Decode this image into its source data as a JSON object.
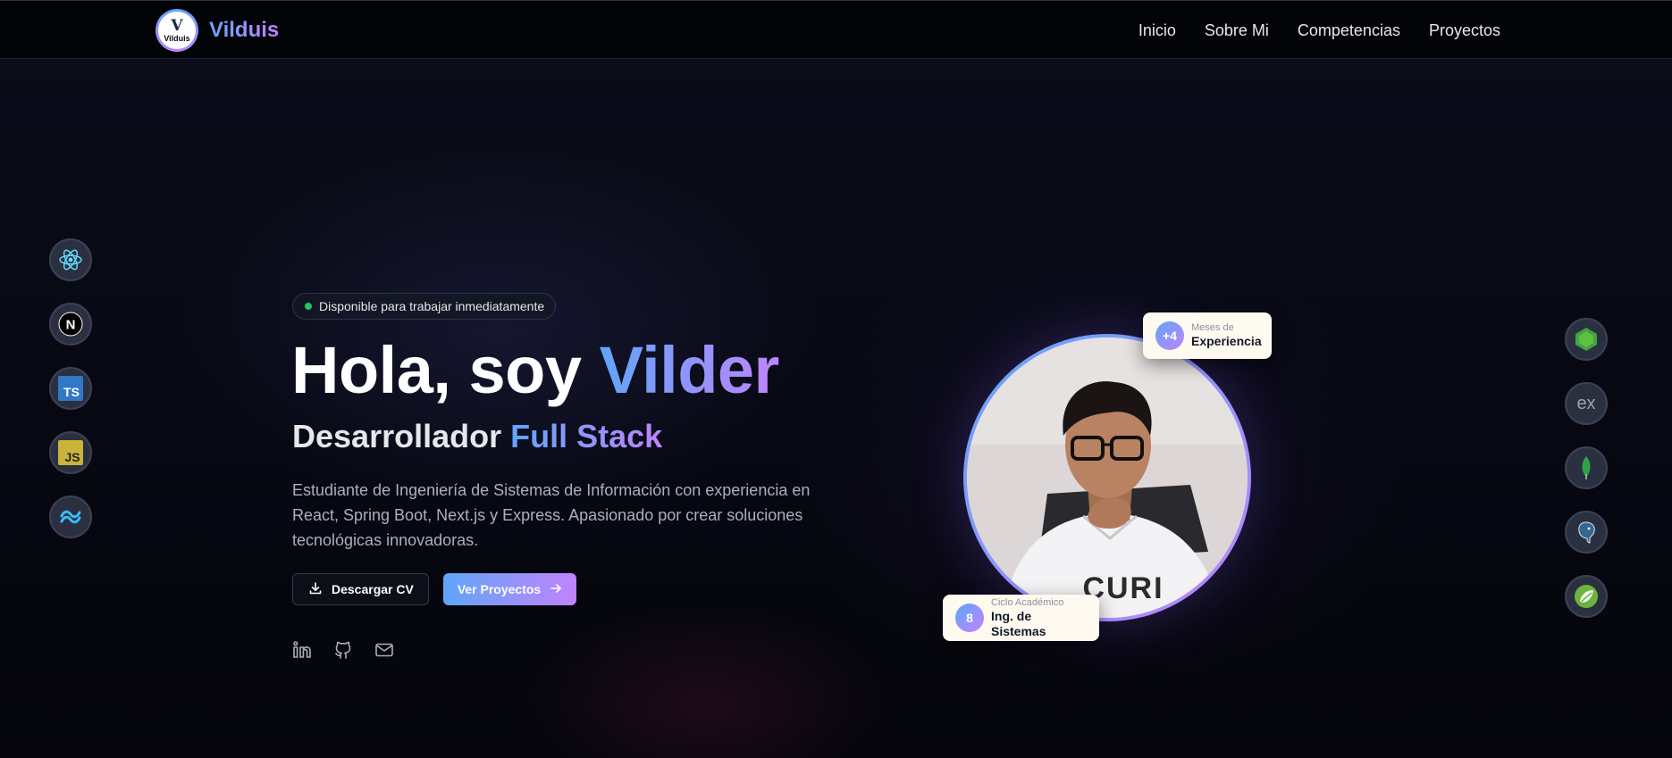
{
  "navbar": {
    "logo_text": "Vilduis",
    "brand_name": "Vilduis",
    "links": [
      "Inicio",
      "Sobre Mi",
      "Competencias",
      "Proyectos"
    ]
  },
  "hero": {
    "availability": "Disponible para trabajar inmediatamente",
    "title_prefix": "Hola, soy ",
    "title_name": "Vilder",
    "subtitle_prefix": "Desarrollador ",
    "subtitle_highlight": "Full Stack",
    "description": "Estudiante de Ingeniería de Sistemas de Información con experiencia en React, Spring Boot, Next.js y Express. Apasionado por crear soluciones tecnológicas innovadoras.",
    "download_cv": "Descargar CV",
    "view_projects": "Ver Proyectos"
  },
  "socials": [
    "linkedin-icon",
    "github-icon",
    "mail-icon"
  ],
  "profile": {
    "experience": {
      "value": "+4",
      "label": "Meses de",
      "title": "Experiencia"
    },
    "cycle": {
      "value": "8",
      "label": "Ciclo Académico",
      "title": "Ing. de Sistemas"
    }
  },
  "tech_left": [
    {
      "icon": "react-icon",
      "text": ""
    },
    {
      "icon": "nextjs-icon",
      "text": "N"
    },
    {
      "icon": "typescript-icon",
      "text": "TS"
    },
    {
      "icon": "javascript-icon",
      "text": "JS"
    },
    {
      "icon": "tailwind-icon",
      "text": ""
    }
  ],
  "tech_right": [
    {
      "icon": "nodejs-icon",
      "text": ""
    },
    {
      "icon": "express-icon",
      "text": "ex"
    },
    {
      "icon": "mongodb-icon",
      "text": ""
    },
    {
      "icon": "postgresql-icon",
      "text": ""
    },
    {
      "icon": "spring-icon",
      "text": ""
    }
  ],
  "colors": {
    "accent_blue": "#60a5fa",
    "accent_purple": "#c084fc",
    "status_green": "#22c55e",
    "background": "#05060c"
  }
}
